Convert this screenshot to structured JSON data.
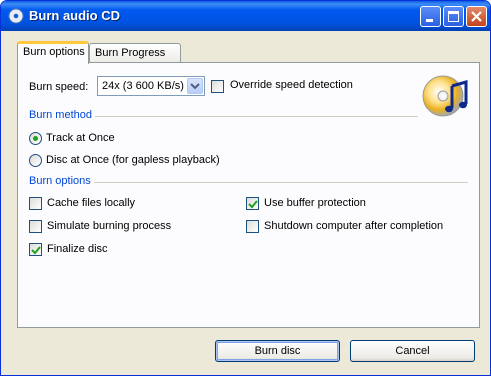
{
  "window": {
    "title": "Burn audio CD",
    "app_icon": "cd-icon"
  },
  "title_buttons": {
    "minimize": "minimize-icon",
    "maximize": "maximize-icon",
    "close": "close-icon"
  },
  "tabs": [
    {
      "label": "Burn options",
      "active": true
    },
    {
      "label": "Burn Progress",
      "active": false
    }
  ],
  "burn_speed": {
    "label": "Burn speed:",
    "value": "24x (3 600 KB/s)",
    "override_label": "Override speed detection",
    "override_checked": false
  },
  "burn_method": {
    "title": "Burn method",
    "options": [
      {
        "label": "Track at Once",
        "selected": true
      },
      {
        "label": "Disc at Once (for gapless playback)",
        "selected": false
      }
    ]
  },
  "burn_options": {
    "title": "Burn options",
    "items": [
      {
        "label": "Cache files locally",
        "checked": false
      },
      {
        "label": "Use buffer protection",
        "checked": true
      },
      {
        "label": "Simulate burning process",
        "checked": false
      },
      {
        "label": "Shutdown computer after completion",
        "checked": false
      },
      {
        "label": "Finalize disc",
        "checked": true
      }
    ]
  },
  "buttons": {
    "burn": "Burn disc",
    "cancel": "Cancel"
  },
  "colors": {
    "titlebar": "#0054e3",
    "group_title": "#0046d5",
    "check": "#21a121",
    "tab_highlight": "#ffc83c"
  }
}
